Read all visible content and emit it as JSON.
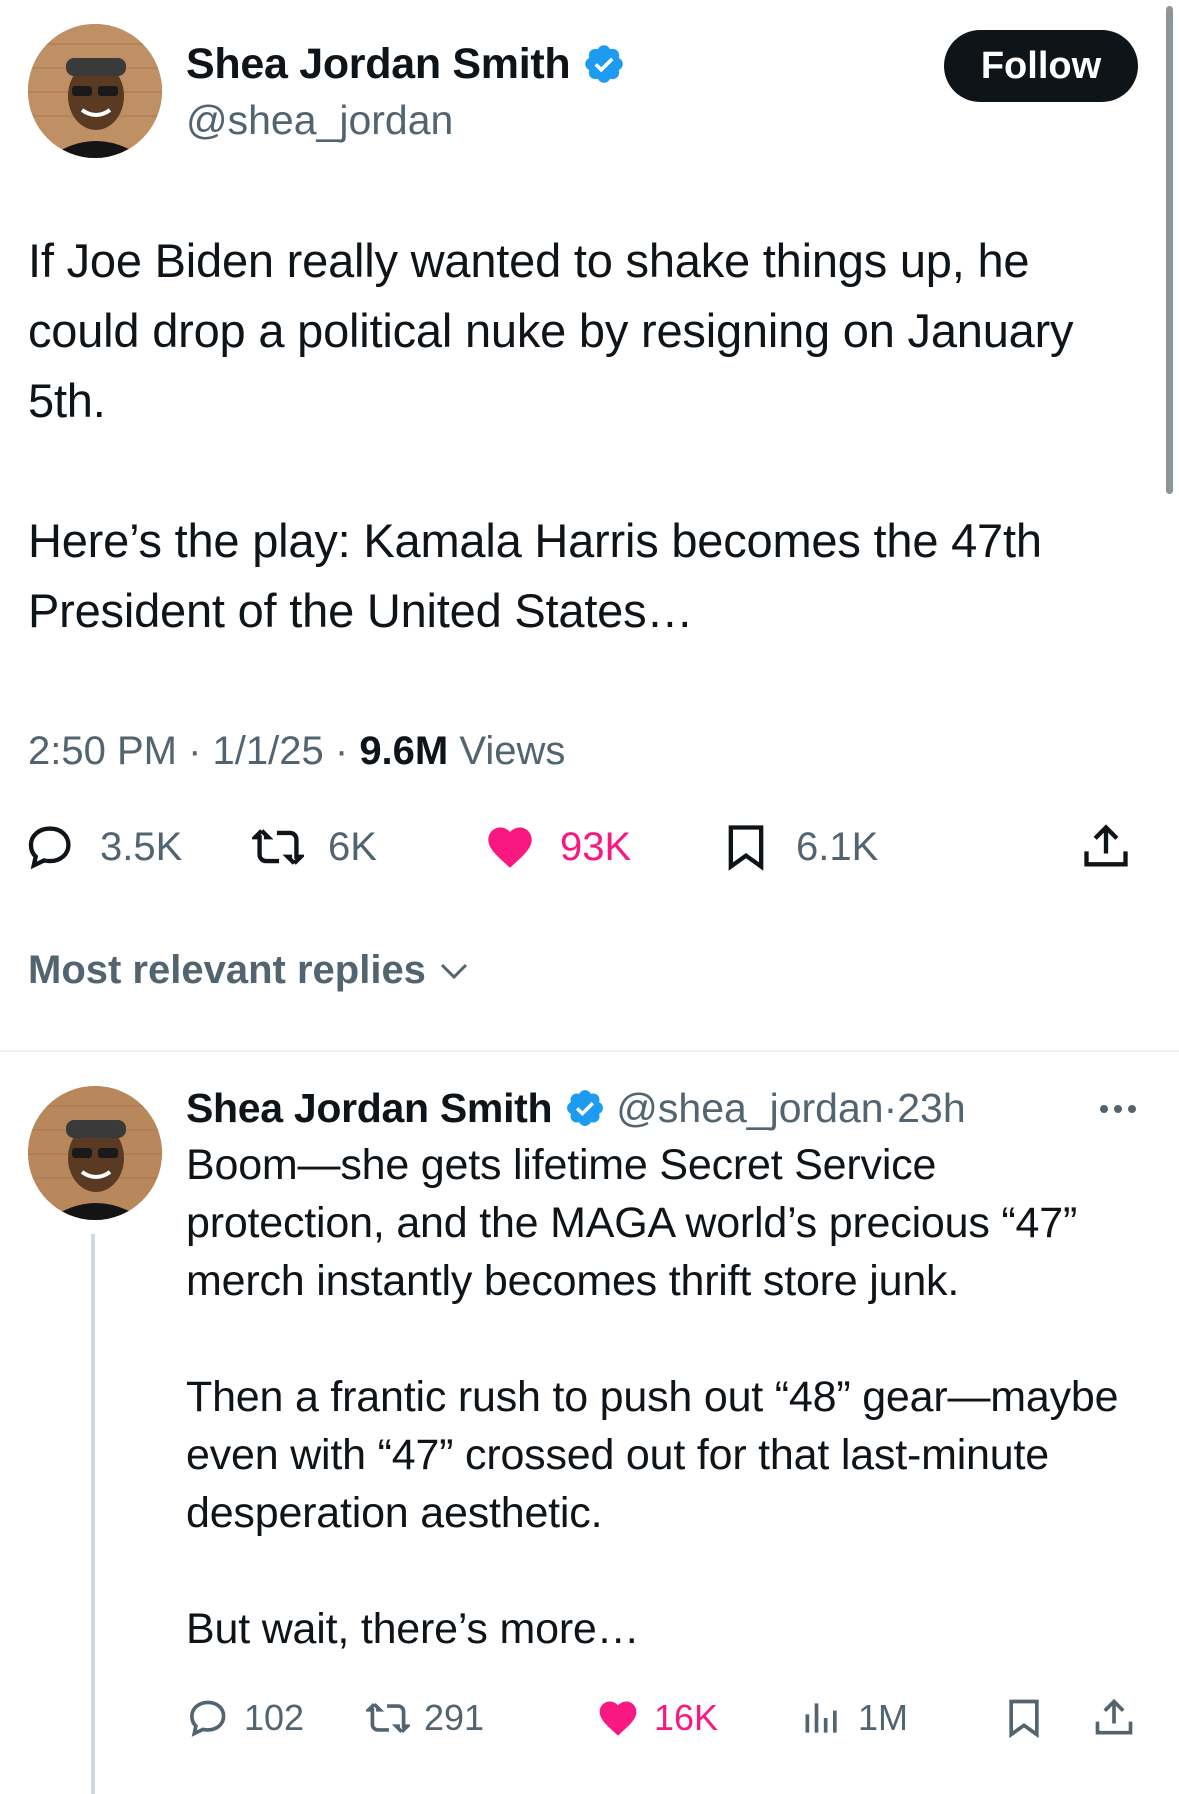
{
  "main_tweet": {
    "display_name": "Shea Jordan Smith",
    "handle": "@shea_jordan",
    "follow_label": "Follow",
    "paragraphs": [
      "If Joe Biden really wanted to shake things up, he could drop a political nuke by resigning on January 5th.",
      "Here’s the play: Kamala Harris becomes the 47th President of the United States…"
    ],
    "time": "2:50 PM",
    "date": "1/1/25",
    "views_count": "9.6M",
    "views_label": "Views",
    "actions": {
      "replies": "3.5K",
      "reposts": "6K",
      "likes": "93K",
      "bookmarks": "6.1K"
    }
  },
  "replies_sort_label": "Most relevant replies",
  "reply": {
    "display_name": "Shea Jordan Smith",
    "handle": "@shea_jordan",
    "age": "23h",
    "paragraphs": [
      "Boom—she gets lifetime Secret Service protection, and the MAGA world’s precious “47” merch instantly becomes thrift store junk.",
      "Then a frantic rush to push out “48” gear—maybe even with “47” crossed out for that last-minute desperation aesthetic.",
      "But wait, there’s more…"
    ],
    "actions": {
      "replies": "102",
      "reposts": "291",
      "likes": "16K",
      "views": "1M"
    }
  },
  "colors": {
    "verified": "#1d9bf0",
    "like": "#f91880",
    "secondary_text": "#536471"
  },
  "icons": [
    "verified-badge-icon",
    "reply-icon",
    "repost-icon",
    "like-icon",
    "bookmark-icon",
    "share-icon",
    "chevron-down-icon",
    "more-icon",
    "views-icon"
  ]
}
